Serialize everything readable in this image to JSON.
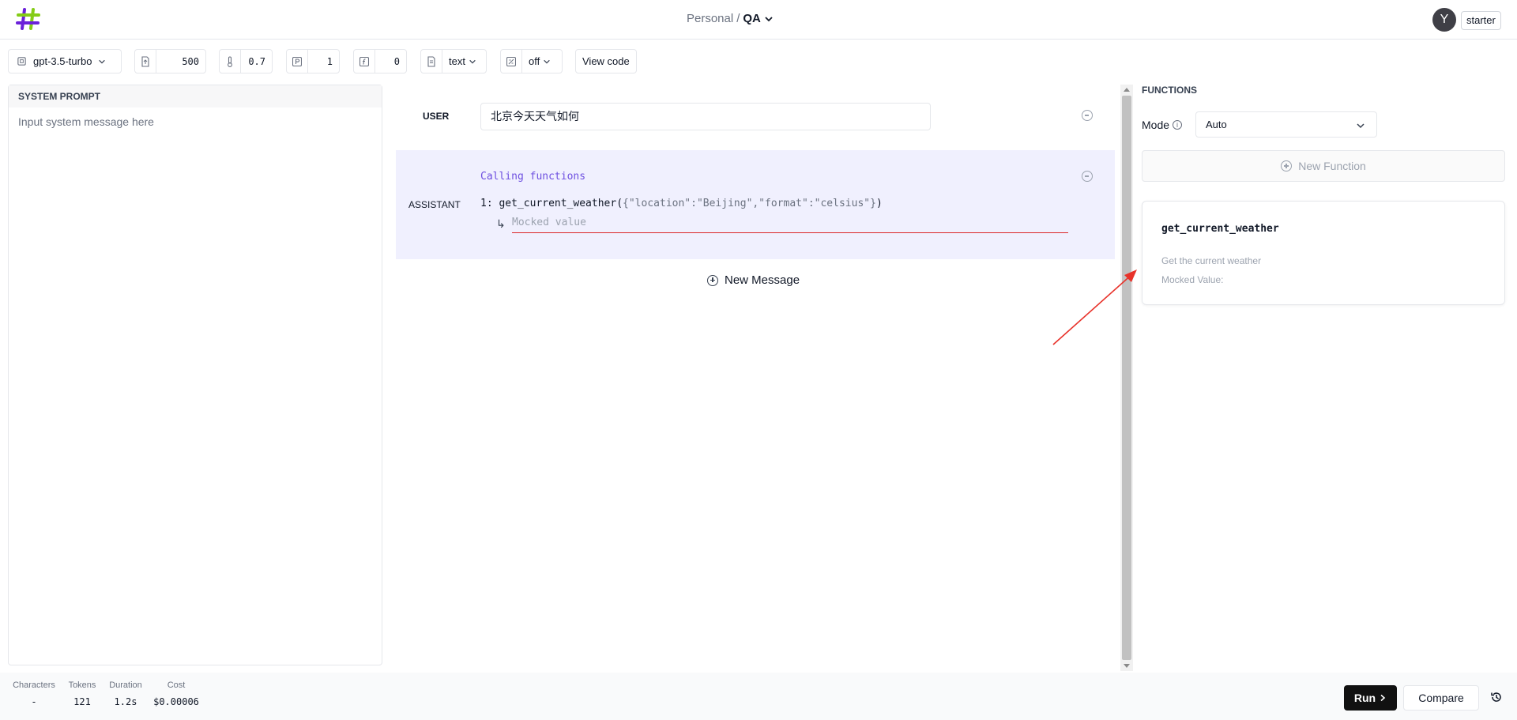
{
  "header": {
    "logo": "hash-logo",
    "workspace": "Personal",
    "separator": "/",
    "project": "QA",
    "avatar_initial": "Y",
    "plan": "starter"
  },
  "toolbar": {
    "model": "gpt-3.5-turbo",
    "max_tokens": "500",
    "temperature": "0.7",
    "top_p": "1",
    "frequency_penalty": "0",
    "response_format": "text",
    "json_mode": "off",
    "view_code_label": "View code"
  },
  "system_prompt": {
    "title": "SYSTEM PROMPT",
    "placeholder": "Input system message here"
  },
  "messages": {
    "user_label": "USER",
    "user_text": "北京今天天气如何",
    "assistant_label": "ASSISTANT",
    "calling_label": "Calling functions",
    "call_index": "1:",
    "call_name": "get_current_weather",
    "call_open": "(",
    "call_args": "{\"location\":\"Beijing\",\"format\":\"celsius\"}",
    "call_close": ")",
    "mock_arrow": "↳",
    "mock_placeholder": "Mocked value",
    "new_message_label": "New Message"
  },
  "functions": {
    "title": "FUNCTIONS",
    "mode_label": "Mode",
    "mode_value": "Auto",
    "new_function_label": "New Function",
    "card": {
      "name": "get_current_weather",
      "description": "Get the current weather",
      "mocked_label": "Mocked Value:"
    }
  },
  "footer": {
    "stats": [
      {
        "key": "Characters",
        "value": "-"
      },
      {
        "key": "Tokens",
        "value": "121"
      },
      {
        "key": "Duration",
        "value": "1.2s"
      },
      {
        "key": "Cost",
        "value": "$0.00006"
      }
    ],
    "run_label": "Run",
    "compare_label": "Compare"
  },
  "colors": {
    "accent_purple": "#6d4fe0",
    "assistant_bg": "#f0f0fe",
    "mock_underline": "#dc2626",
    "annotation_arrow": "#e8322a"
  }
}
